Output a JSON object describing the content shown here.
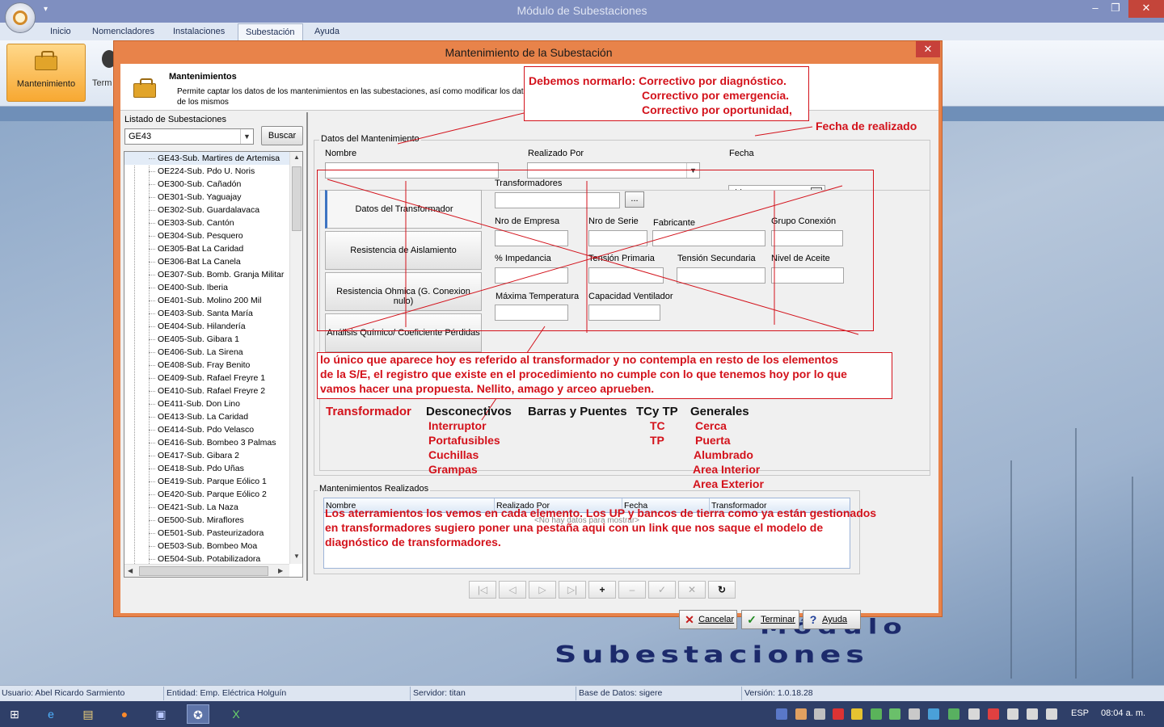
{
  "app": {
    "title": "Módulo de Subestaciones",
    "ribbon_tabs": [
      "Inicio",
      "Nomencladores",
      "Instalaciones",
      "Subestación",
      "Ayuda"
    ],
    "ribbon_buttons": {
      "mantenimiento": "Mantenimiento",
      "terminar_partial": "Term"
    },
    "logo": [
      "Módulo",
      "Subestaciones"
    ],
    "window_controls": {
      "minimize": "–",
      "restore": "❐",
      "close": "✕"
    }
  },
  "dialog": {
    "title": "Mantenimiento de la Subestación",
    "header_title": "Mantenimientos",
    "header_desc": "Permite captar los datos de los mantenimientos en las subestaciones, así como modificar los datos de los mismos",
    "listado_label": "Listado de Subestaciones",
    "combo_value": "GE43",
    "buscar": "Buscar",
    "tree_items": [
      "GE43-Sub. Martires de Artemisa",
      "OE224-Sub. Pdo U. Noris",
      "OE300-Sub. Cañadón",
      "OE301-Sub. Yaguajay",
      "OE302-Sub. Guardalavaca",
      "OE303-Sub. Cantón",
      "OE304-Sub. Pesquero",
      "OE305-Bat La Caridad",
      "OE306-Bat La Canela",
      "OE307-Sub. Bomb. Granja Militar",
      "OE400-Sub. Iberia",
      "OE401-Sub. Molino 200 Mil",
      "OE403-Sub. Santa María",
      "OE404-Sub. Hilandería",
      "OE405-Sub. Gibara 1",
      "OE406-Sub. La Sirena",
      "OE408-Sub. Fray Benito",
      "OE409-Sub. Rafael Freyre 1",
      "OE410-Sub. Rafael Freyre 2",
      "OE411-Sub. Don Lino",
      "OE413-Sub. La Caridad",
      "OE414-Sub. Pdo Velasco",
      "OE416-Sub. Bombeo 3 Palmas",
      "OE417-Sub. Gibara 2",
      "OE418-Sub. Pdo Uñas",
      "OE419-Sub. Parque Eólico 1",
      "OE420-Sub. Parque Eólico 2",
      "OE421-Sub. La Naza",
      "OE500-Sub. Miraflores",
      "OE501-Sub. Pasteurizadora",
      "OE503-Sub. Bombeo Moa",
      "OE504-Sub. Potabilizadora"
    ],
    "group_datos": "Datos del Mantenimiento",
    "fields": {
      "nombre": "Nombre",
      "realizado_por": "Realizado Por",
      "fecha": "Fecha",
      "fecha_value": "/ /"
    },
    "tabs": [
      "Datos del Transformador",
      "Resistencia de Aislamiento",
      "Resistencia Ohmica (G. Conexion nulo)",
      "Análisis Químico/ Coeficiente Pérdidas"
    ],
    "transformer_fields": {
      "transformadores": "Transformadores",
      "browse": "...",
      "nro_empresa": "Nro de Empresa",
      "nro_serie": "Nro de Serie",
      "fabricante": "Fabricante",
      "grupo_conexion": "Grupo Conexión",
      "impedancia": "% Impedancia",
      "tension_primaria": "Tensión Primaria",
      "tension_secundaria": "Tensión Secundaria",
      "nivel_aceite": "Nivel de Aceite",
      "max_temperatura": "Máxima Temperatura",
      "capacidad_ventilador": "Capacidad Ventilador"
    },
    "group_realizados": "Mantenimientos Realizados",
    "grid_columns": [
      "Nombre",
      "Realizado Por",
      "Fecha",
      "Transformador"
    ],
    "grid_empty": "<No hay datos para mostrar>",
    "navigator": [
      "|◁",
      "◁",
      "▷",
      "▷|",
      "+",
      "–",
      "✓",
      "✕",
      "↻"
    ],
    "buttons": {
      "cancelar": "Cancelar",
      "terminar": "Terminar",
      "ayuda": "Ayuda"
    },
    "close": "✕"
  },
  "annotations": {
    "top": [
      "Debemos normarlo: Correctivo por diagnóstico.",
      "Correctivo por emergencia.",
      "Correctivo por oportunidad,"
    ],
    "fecha": "Fecha de realizado",
    "middle": [
      "lo único que aparece hoy es referido al transformador y no contempla en resto de los elementos",
      "de la S/E, el registro que existe en el procedimiento no cumple con lo que tenemos hoy por lo que",
      "vamos hacer una propuesta. Nellito, amago y arceo aprueben."
    ],
    "categories": [
      "Transformador",
      "Desconectivos",
      "Barras y Puentes",
      "TCy TP",
      "Generales"
    ],
    "desconectivos": [
      "Interruptor",
      "Portafusibles",
      "Cuchillas",
      "Grampas"
    ],
    "tctp": [
      "TC",
      "TP"
    ],
    "generales": [
      "Cerca",
      "Puerta",
      "Alumbrado",
      "Area Interior",
      "Area Exterior"
    ],
    "bottom": [
      "Los aterramientos los vemos en cada elemento. Los UP y bancos de tierra como ya están gestionados",
      "en transformadores sugiero poner una pestaña aqui con un link que nos saque el modelo de",
      "diagnóstico de transformadores."
    ]
  },
  "statusbar": {
    "usuario": "Usuario: Abel Ricardo Sarmiento",
    "entidad": "Entidad: Emp. Eléctrica Holguín",
    "servidor": "Servidor: titan",
    "bd": "Base de Datos: sigere",
    "version": "Versión: 1.0.18.28"
  },
  "taskbar": {
    "lang": "ESP",
    "clock": "08:04 a. m."
  },
  "colors": {
    "annotation": "#d3121b",
    "dialog_border": "#e8834a",
    "ribbon_active": "#f7a832"
  }
}
